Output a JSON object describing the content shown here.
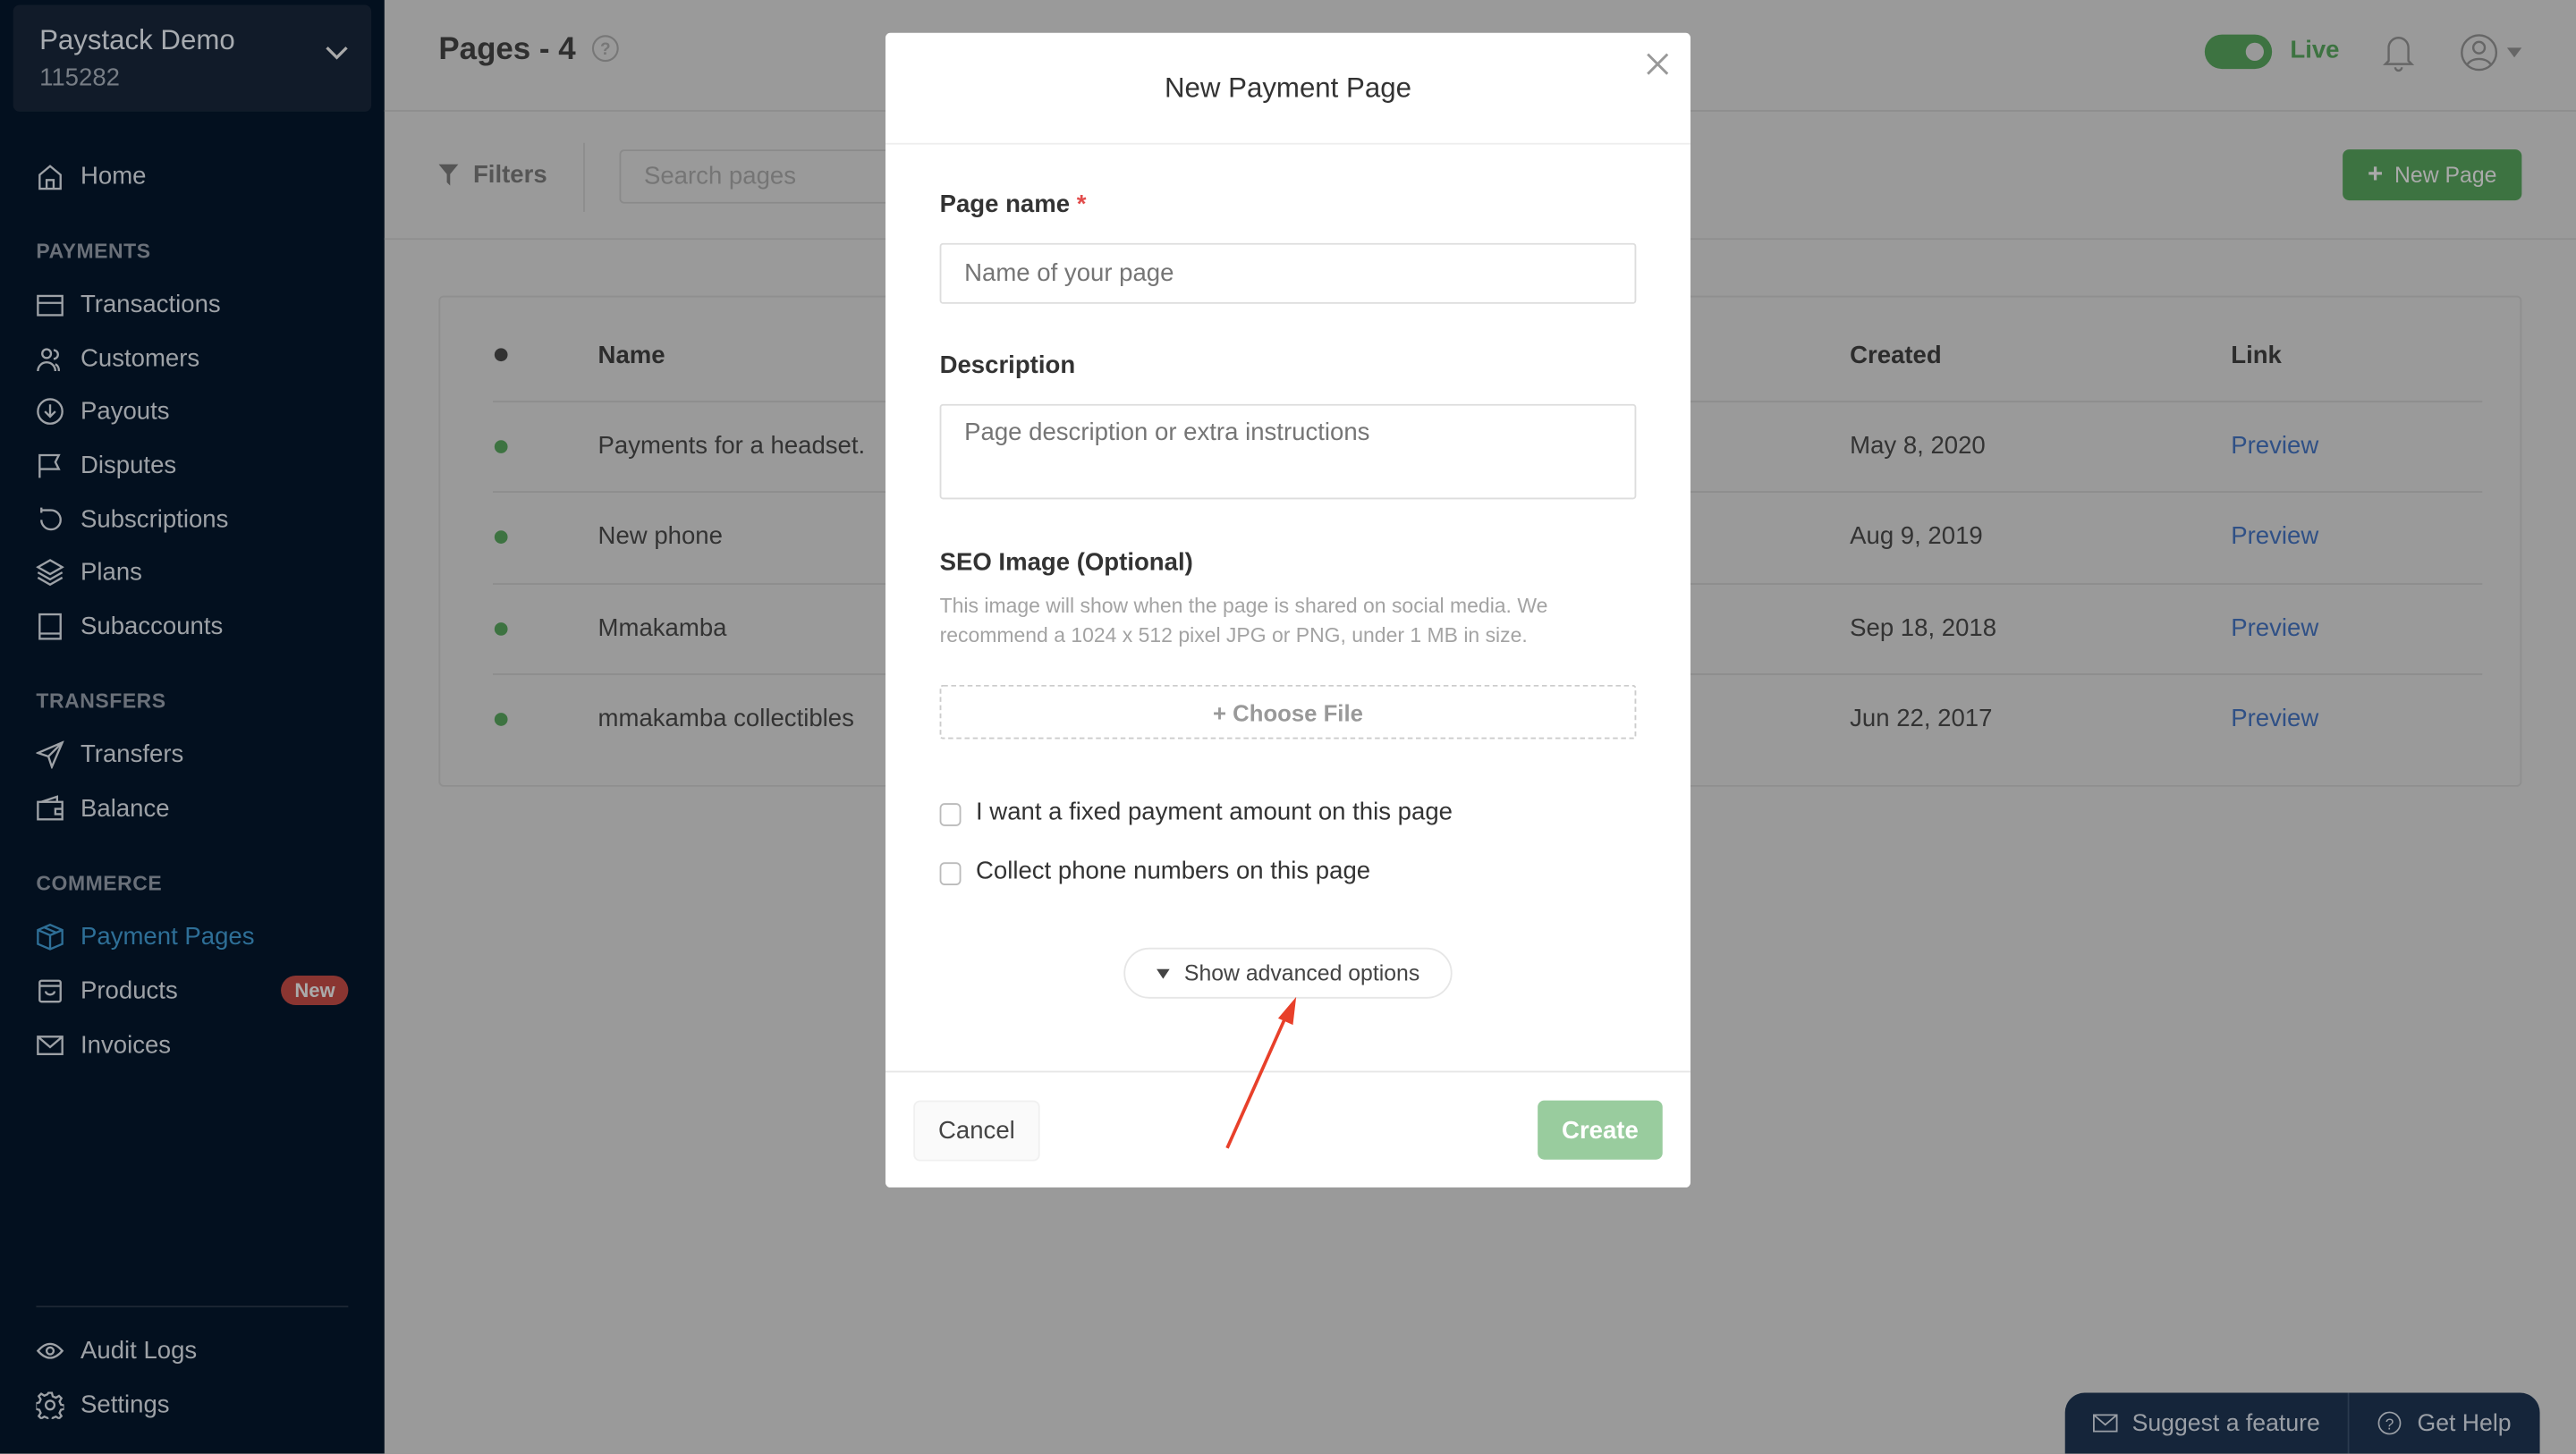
{
  "account": {
    "name": "Paystack Demo",
    "id": "115282"
  },
  "sidebar": {
    "home": "Home",
    "sections": [
      {
        "title": "PAYMENTS",
        "items": [
          {
            "label": "Transactions",
            "icon": "card-icon"
          },
          {
            "label": "Customers",
            "icon": "users-icon"
          },
          {
            "label": "Payouts",
            "icon": "payout-icon"
          },
          {
            "label": "Disputes",
            "icon": "flag-icon"
          },
          {
            "label": "Subscriptions",
            "icon": "refresh-icon"
          },
          {
            "label": "Plans",
            "icon": "layers-icon"
          },
          {
            "label": "Subaccounts",
            "icon": "book-icon"
          }
        ]
      },
      {
        "title": "TRANSFERS",
        "items": [
          {
            "label": "Transfers",
            "icon": "send-icon"
          },
          {
            "label": "Balance",
            "icon": "wallet-icon"
          }
        ]
      },
      {
        "title": "COMMERCE",
        "items": [
          {
            "label": "Payment Pages",
            "icon": "box-icon",
            "active": true
          },
          {
            "label": "Products",
            "icon": "bag-icon",
            "badge": "New"
          },
          {
            "label": "Invoices",
            "icon": "mail-icon"
          }
        ]
      }
    ],
    "bottom": [
      {
        "label": "Audit Logs",
        "icon": "eye-icon"
      },
      {
        "label": "Settings",
        "icon": "gear-icon"
      }
    ]
  },
  "header": {
    "title": "Pages - 4",
    "mode": "Live"
  },
  "toolbar": {
    "filters": "Filters",
    "search_placeholder": "Search pages",
    "new_page": "New Page"
  },
  "table": {
    "columns": [
      "Name",
      "Created",
      "Link"
    ],
    "rows": [
      {
        "name": "Payments for a headset.",
        "created": "May 8, 2020",
        "link": "Preview"
      },
      {
        "name": "New phone",
        "created": "Aug 9, 2019",
        "link": "Preview"
      },
      {
        "name": "Mmakamba",
        "created": "Sep 18, 2018",
        "link": "Preview"
      },
      {
        "name": "mmakamba collectibles",
        "created": "Jun 22, 2017",
        "link": "Preview"
      }
    ]
  },
  "modal": {
    "title": "New Payment Page",
    "page_name_label": "Page name",
    "required_mark": "*",
    "page_name_placeholder": "Name of your page",
    "description_label": "Description",
    "description_placeholder": "Page description or extra instructions",
    "seo_label": "SEO Image (Optional)",
    "seo_help": "This image will show when the page is shared on social media. We recommend a 1024 x 512 pixel JPG or PNG, under 1 MB in size.",
    "choose_file": "+ Choose File",
    "fixed_amount": "I want a fixed payment amount on this page",
    "collect_phone": "Collect phone numbers on this page",
    "advanced": "Show advanced options",
    "cancel": "Cancel",
    "create": "Create"
  },
  "widget": {
    "suggest": "Suggest a feature",
    "help": "Get Help"
  },
  "colors": {
    "accent_green": "#3d7341",
    "create_disabled": "#99cc9e",
    "sidebar": "#03101f",
    "active_nav": "#2e6f97",
    "badge": "#8a3531",
    "annotation_arrow": "#e8402a"
  }
}
